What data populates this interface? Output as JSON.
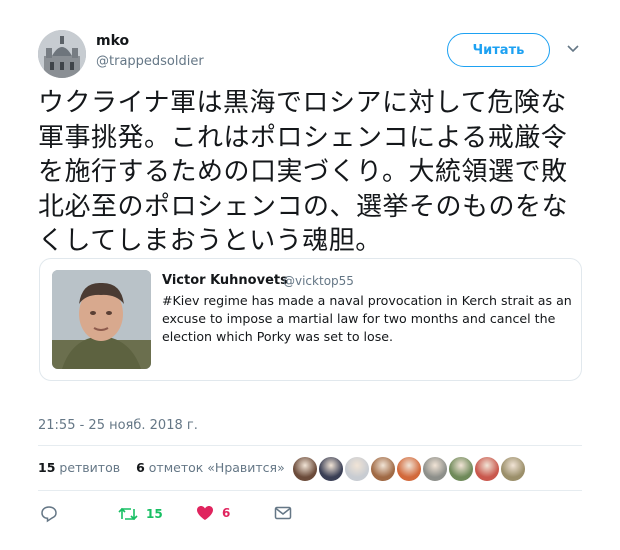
{
  "author": {
    "display_name": "mko",
    "handle": "@trappedsoldier",
    "avatar_icon": "church-dome-avatar"
  },
  "follow_button": {
    "label": "Читать"
  },
  "menu": {
    "icon": "chevron-down-icon"
  },
  "tweet_text_lines": [
    "ウクライナ軍は黒海でロシアに対して危険な",
    "軍事挑発。これはポロシェンコによる戒厳令",
    "を施行するための口実づくり。大統領選で敗",
    "北必至のポロシェンコの、選挙そのものをな",
    "くしてしまおうという魂胆。"
  ],
  "quote": {
    "name": "Victor Kuhnovets",
    "handle": "@vicktop55",
    "text_lines": [
      "#Kiev regime has made a naval provocation in Kerch strait as an",
      "excuse to impose a martial law for two months and cancel the",
      "election which Porky was set to lose."
    ]
  },
  "timestamp": "21:55 - 25 нояб. 2018 г.",
  "stats": {
    "retweets_count": "15",
    "retweets_label": "ретвитов",
    "likes_count": "6",
    "likes_label": "отметок «Нравится»"
  },
  "liker_colors": [
    "#6b4b3a",
    "#3a3f55",
    "#c8ccd2",
    "#a06a45",
    "#d2693b",
    "#8d8f8a",
    "#6f8a5a",
    "#c9584d",
    "#9b8f6a"
  ],
  "actions": {
    "reply_icon": "reply-icon",
    "retweet_icon": "retweet-icon",
    "retweet_count": "15",
    "like_icon": "heart-icon",
    "like_count": "6",
    "dm_icon": "envelope-icon"
  },
  "colors": {
    "accent": "#1da1f2",
    "retweet_green": "#17bf63",
    "like_red": "#e0245e",
    "secondary_text": "#657786"
  }
}
